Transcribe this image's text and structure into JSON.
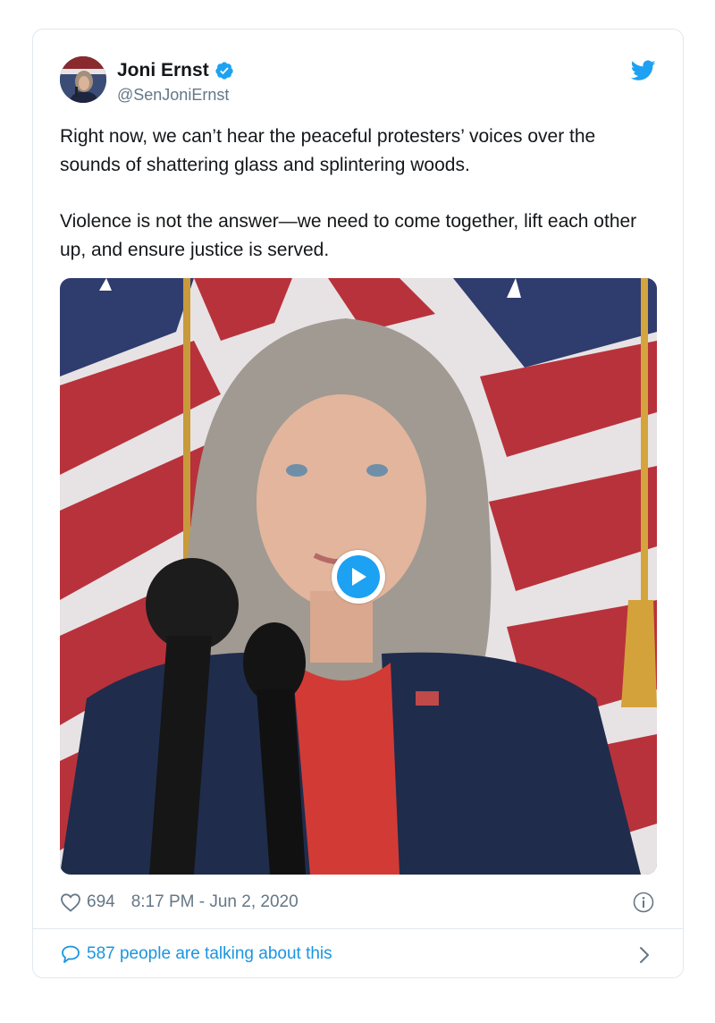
{
  "author": {
    "name": "Joni Ernst",
    "handle": "@SenJoniErnst",
    "verified": true
  },
  "tweet": {
    "paragraphs": [
      "Right now, we can’t hear the peaceful protesters’ voices over the sounds of shattering glass and splintering woods.",
      "Violence is not the answer—we need to come together, lift each other up, and ensure justice is served."
    ]
  },
  "media": {
    "type": "video",
    "icon": "play-icon"
  },
  "meta": {
    "likes": "694",
    "timestamp": "8:17 PM - Jun 2, 2020"
  },
  "footer": {
    "talking_text": "587 people are talking about this"
  },
  "colors": {
    "accent": "#1da1f2",
    "link": "#1b95e0",
    "text": "#14171a",
    "muted": "#657786",
    "border": "#e1e8ed"
  },
  "icons": [
    "verified-badge-icon",
    "twitter-bird-icon",
    "play-icon",
    "heart-icon",
    "info-icon",
    "speech-bubble-icon",
    "chevron-right-icon"
  ]
}
